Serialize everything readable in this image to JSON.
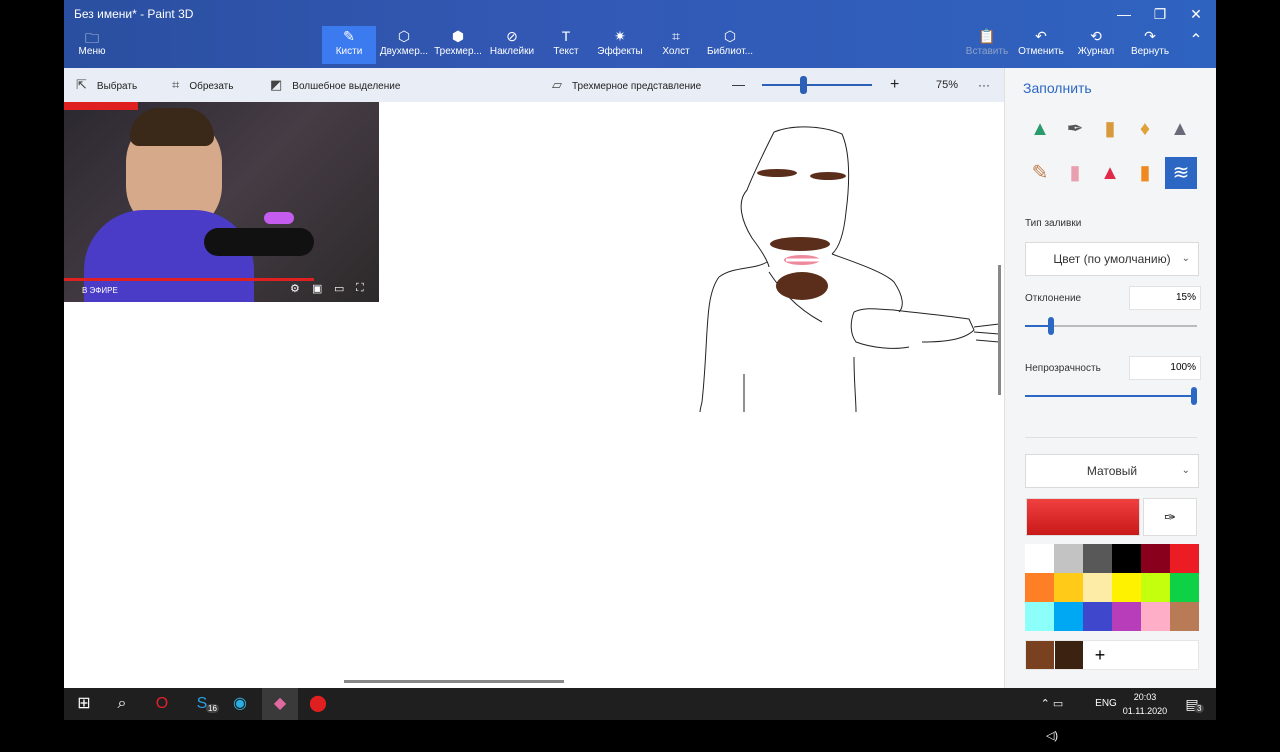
{
  "window": {
    "title": "Без имени* - Paint 3D",
    "min": "—",
    "max": "❐",
    "close": "✕"
  },
  "menu": {
    "label": "Меню"
  },
  "tools": [
    {
      "label": "Кисти",
      "icon": "✎"
    },
    {
      "label": "Двухмер...",
      "icon": "⬡"
    },
    {
      "label": "Трехмер...",
      "icon": "⬢"
    },
    {
      "label": "Наклейки",
      "icon": "⊘"
    },
    {
      "label": "Текст",
      "icon": "T"
    },
    {
      "label": "Эффекты",
      "icon": "✷"
    },
    {
      "label": "Холст",
      "icon": "⌗"
    },
    {
      "label": "Библиот...",
      "icon": "⬡"
    }
  ],
  "actions": [
    {
      "label": "Вставить",
      "icon": "📋"
    },
    {
      "label": "Отменить",
      "icon": "↶"
    },
    {
      "label": "Журнал",
      "icon": "⟲"
    },
    {
      "label": "Вернуть",
      "icon": "↷"
    }
  ],
  "collapse_icon": "⌃",
  "subtoolbar": {
    "select": "Выбрать",
    "crop": "Обрезать",
    "magic": "Волшебное выделение",
    "view3d": "Трехмерное представление",
    "zoom_minus": "—",
    "zoom_plus": "+",
    "zoom": "75%",
    "more": "···"
  },
  "webcam": {
    "live": "В ЭФИРЕ"
  },
  "panel": {
    "title": "Заполнить",
    "fill_type_label": "Тип заливки",
    "fill_type_value": "Цвет (по умолчанию)",
    "deviation_label": "Отклонение",
    "deviation_value": "15%",
    "deviation_fraction": 0.15,
    "opacity_label": "Непрозрачность",
    "opacity_value": "100%",
    "opacity_fraction": 1.0,
    "finish_value": "Матовый",
    "selected_color": "#e8282c",
    "add_label": "+"
  },
  "palette": [
    "#ffffff",
    "#c3c3c3",
    "#585858",
    "#000000",
    "#88001b",
    "#ec1c24",
    "#ff7f27",
    "#ffca18",
    "#fdeca6",
    "#fff200",
    "#c4ff0e",
    "#0ed145",
    "#8cfffb",
    "#00a8f3",
    "#3f48cc",
    "#b83dba",
    "#ffaec8",
    "#b97a56"
  ],
  "custom_colors": [
    "#7a4120",
    "#3c2210"
  ],
  "taskbar": {
    "lang": "ENG",
    "time": "20:03",
    "date": "01.11.2020",
    "skype_badge": "16",
    "notif_badge": "3"
  }
}
